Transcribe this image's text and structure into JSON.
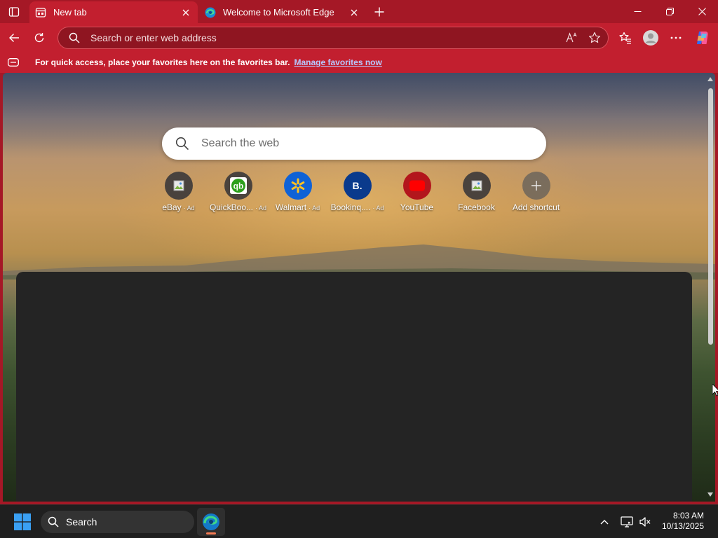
{
  "browser": {
    "tabs": [
      {
        "title": "New tab",
        "active": true,
        "icon": "new-tab-page-icon"
      },
      {
        "title": "Welcome to Microsoft Edge",
        "active": false,
        "icon": "edge-logo-icon"
      }
    ],
    "address_placeholder": "Search or enter web address",
    "favorites_bar": {
      "message": "For quick access, place your favorites here on the favorites bar.",
      "link": "Manage favorites now"
    },
    "colors": {
      "frame": "#a51826",
      "toolbar": "#c21f2f",
      "link": "#b7c8ff"
    }
  },
  "new_tab": {
    "search_placeholder": "Search the web",
    "shortcuts": [
      {
        "label": "eBay",
        "ad": "· Ad",
        "icon": "broken-image-icon"
      },
      {
        "label": "QuickBoo...",
        "ad": "· Ad",
        "icon": "quickbooks-logo-icon"
      },
      {
        "label": "Walmart",
        "ad": "· Ad",
        "icon": "walmart-logo-icon"
      },
      {
        "label": "Bookinq....",
        "ad": "· Ad",
        "icon": "booking-logo-icon",
        "glyph": "B."
      },
      {
        "label": "YouTube",
        "ad": "",
        "icon": "youtube-logo-icon"
      },
      {
        "label": "Facebook",
        "ad": "",
        "icon": "broken-image-icon"
      },
      {
        "label": "Add shortcut",
        "ad": "",
        "icon": "plus-icon",
        "glyph": "+"
      }
    ]
  },
  "taskbar": {
    "search_label": "Search",
    "time": "8:03 AM",
    "date": "10/13/2025"
  }
}
